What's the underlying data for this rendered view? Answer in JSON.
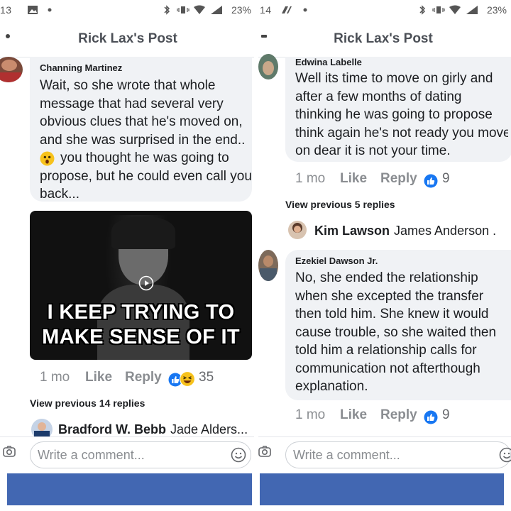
{
  "colors": {
    "brand_blue": "#4267b2",
    "like_blue": "#1877f2",
    "bubble_bg": "#f0f2f5",
    "muted": "#8a8d91"
  },
  "left": {
    "status": {
      "time": "13",
      "battery": "23%"
    },
    "header": {
      "title": "Rick Lax's Post"
    },
    "comment": {
      "author": "Channing Martinez",
      "lines": [
        "Wait, so she wrote that whole",
        "message that had several very",
        "obvious clues that he's moved on,",
        "and she was surprised in the end..",
        "you thought he was going to",
        "propose, but he could even call you",
        "back..."
      ],
      "emoji_icon": "astonished-face-icon"
    },
    "gif": {
      "caption_line1": "I KEEP TRYING TO",
      "caption_line2": "MAKE SENSE OF IT",
      "icon": "play-icon"
    },
    "actions": {
      "time": "1 mo",
      "like": "Like",
      "reply": "Reply",
      "count": "35"
    },
    "view_previous": "View previous 14 replies",
    "reply_preview": {
      "name": "Bradford W. Bebb",
      "to": "Jade Alders..."
    },
    "composer": {
      "placeholder": "Write a comment..."
    }
  },
  "right": {
    "status": {
      "time": "14",
      "battery": "23%"
    },
    "header": {
      "title": "Rick Lax's Post"
    },
    "comment1": {
      "author": "Edwina Labelle",
      "lines": [
        "Well its time to move on girly and",
        "after a few months of dating",
        "thinking he was going to propose",
        "think again he's not ready you move",
        "on dear it is not your time."
      ]
    },
    "actions1": {
      "time": "1 mo",
      "like": "Like",
      "reply": "Reply",
      "count": "9"
    },
    "view_previous": "View previous 5 replies",
    "reply_preview": {
      "name": "Kim Lawson",
      "to": "James Anderson ."
    },
    "comment2": {
      "author": "Ezekiel Dawson Jr.",
      "lines": [
        "No, she ended the relationship",
        "when she excepted the transfer",
        "then told him. She knew it would",
        "cause trouble, so she waited then",
        "told him a relationship calls for",
        "communication not afterthough",
        "explanation."
      ]
    },
    "actions2": {
      "time": "1 mo",
      "like": "Like",
      "reply": "Reply",
      "count": "9"
    },
    "composer": {
      "placeholder": "Write a comment..."
    }
  }
}
